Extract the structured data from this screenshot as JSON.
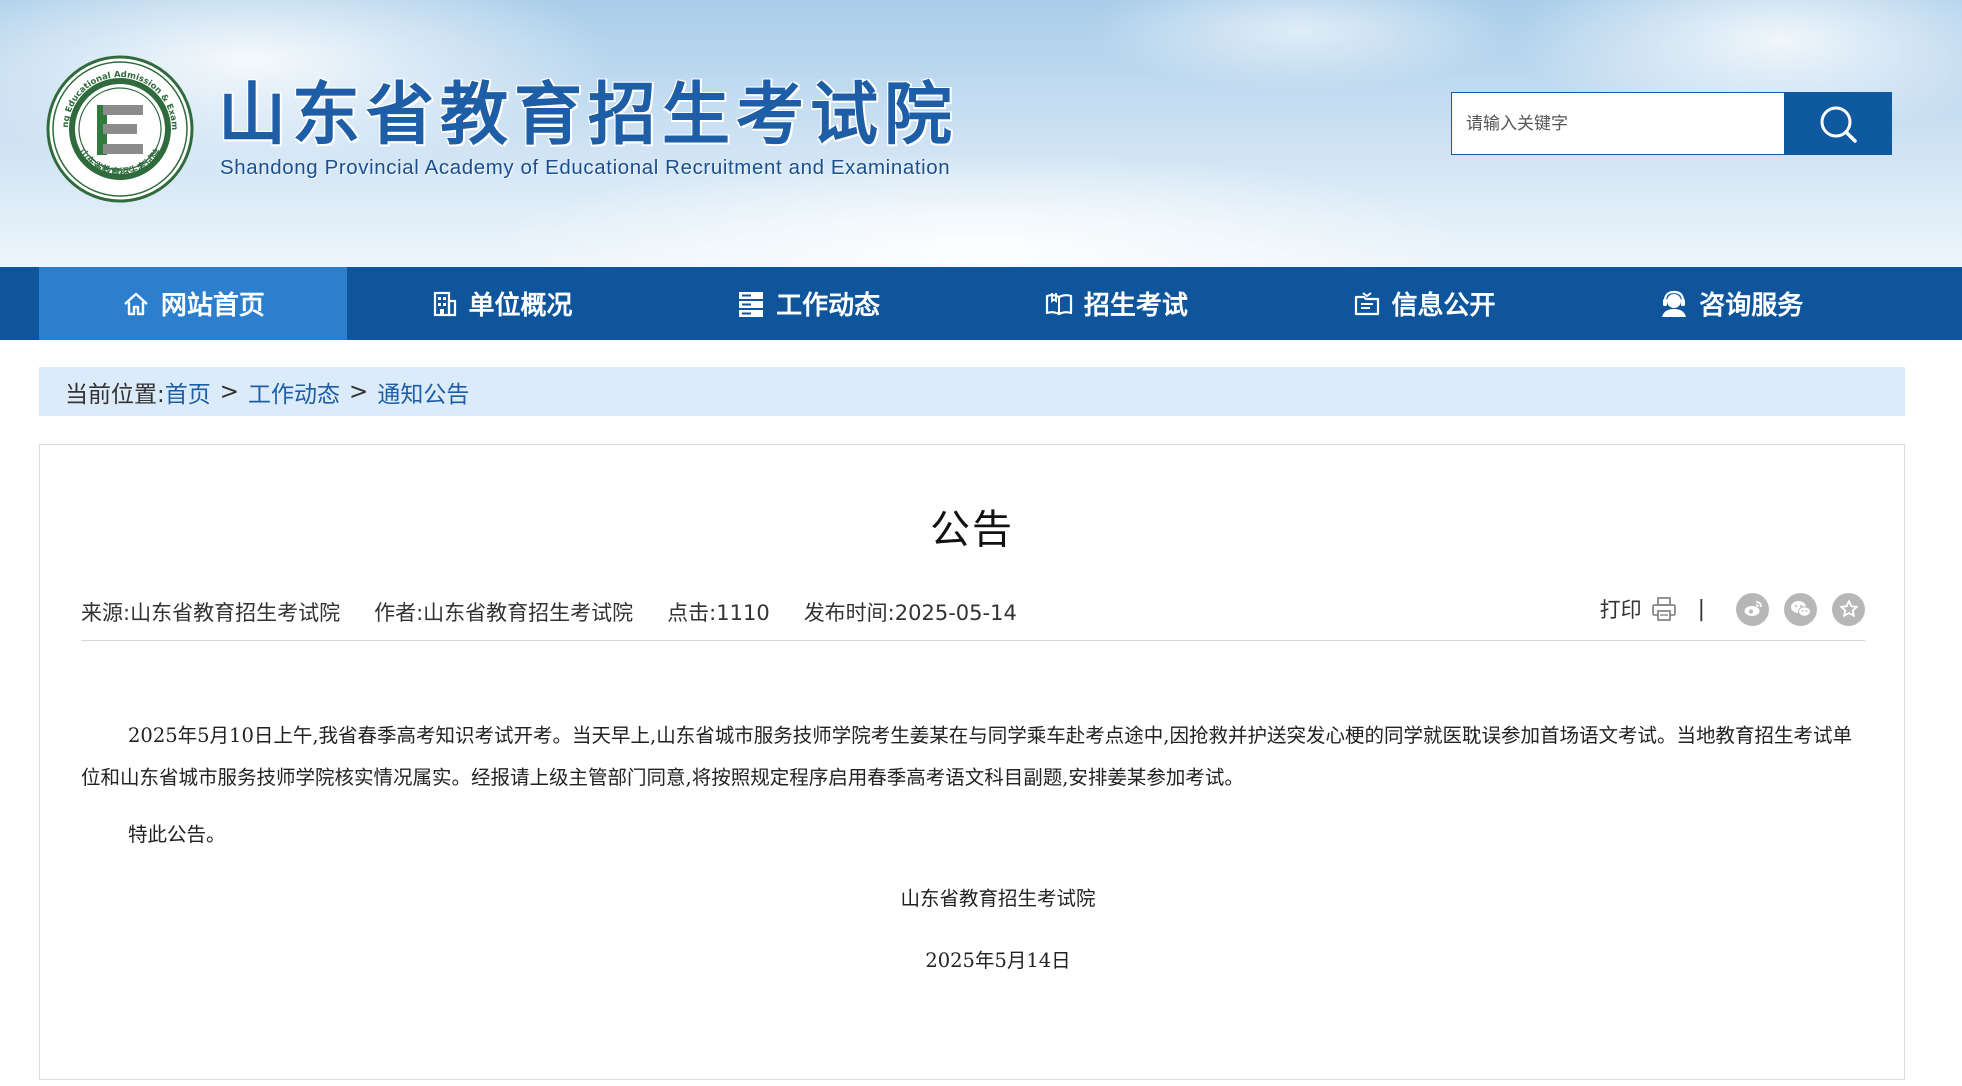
{
  "header": {
    "title_cn": "山东省教育招生考试院",
    "title_en": "Shandong Provincial Academy of Educational Recruitment and Examination",
    "logo": {
      "icon": "academy-seal-logo",
      "ring_text_top": "Shandong Educational Admission & Examination",
      "ring_text_bottom": "山东省教育招生考试院",
      "letter": "E"
    }
  },
  "search": {
    "placeholder": "请输入关键字",
    "value": "",
    "button_icon": "search-icon"
  },
  "nav": {
    "items": [
      {
        "label": "网站首页",
        "icon": "home-icon",
        "active": true
      },
      {
        "label": "单位概况",
        "icon": "building-icon",
        "active": false
      },
      {
        "label": "工作动态",
        "icon": "server-list-icon",
        "active": false
      },
      {
        "label": "招生考试",
        "icon": "open-book-icon",
        "active": false
      },
      {
        "label": "信息公开",
        "icon": "folder-doc-icon",
        "active": false
      },
      {
        "label": "咨询服务",
        "icon": "headset-user-icon",
        "active": false
      }
    ]
  },
  "breadcrumb": {
    "prefix": "当前位置:",
    "items": [
      "首页",
      "工作动态",
      "通知公告"
    ],
    "separator": ">"
  },
  "article": {
    "title": "公告",
    "meta": {
      "source": "来源:山东省教育招生考试院",
      "author": "作者:山东省教育招生考试院",
      "clicks": "点击:1110",
      "published": "发布时间:2025-05-14"
    },
    "tools": {
      "print_label": "打印",
      "divider": "|",
      "share_icons": [
        "weibo-icon",
        "wechat-icon",
        "favorite-star-icon"
      ]
    },
    "paragraphs": [
      "2025年5月10日上午,我省春季高考知识考试开考。当天早上,山东省城市服务技师学院考生姜某在与同学乘车赴考点途中,因抢救并护送突发心梗的同学就医耽误参加首场语文考试。当地教育招生考试单位和山东省城市服务技师学院核实情况属实。经报请上级主管部门同意,将按照规定程序启用春季高考语文科目副题,安排姜某参加考试。"
    ],
    "closing": "特此公告。",
    "signature_org": "山东省教育招生考试院",
    "signature_date": "2025年5月14日"
  },
  "colors": {
    "brand_blue": "#0e559c",
    "nav_active": "#2b7fcc",
    "title_blue": "#1e5ea6",
    "breadcrumb_bg": "#dcebfa"
  }
}
